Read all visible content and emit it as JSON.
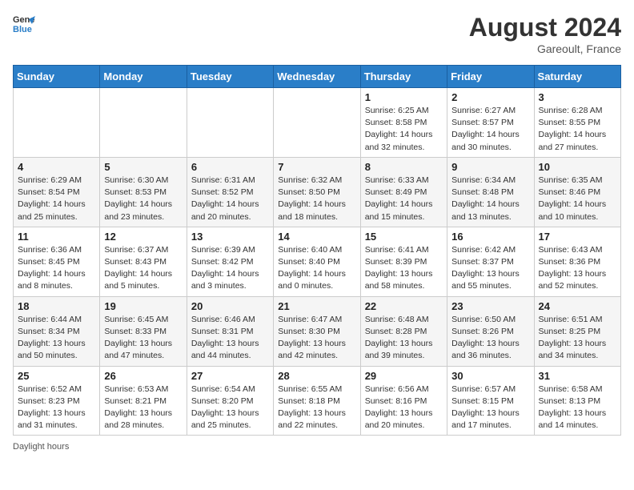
{
  "header": {
    "logo_general": "General",
    "logo_blue": "Blue",
    "month_year": "August 2024",
    "location": "Gareoult, France"
  },
  "footer": {
    "note": "Daylight hours"
  },
  "weekdays": [
    "Sunday",
    "Monday",
    "Tuesday",
    "Wednesday",
    "Thursday",
    "Friday",
    "Saturday"
  ],
  "weeks": [
    [
      {
        "day": "",
        "info": ""
      },
      {
        "day": "",
        "info": ""
      },
      {
        "day": "",
        "info": ""
      },
      {
        "day": "",
        "info": ""
      },
      {
        "day": "1",
        "info": "Sunrise: 6:25 AM\nSunset: 8:58 PM\nDaylight: 14 hours and 32 minutes."
      },
      {
        "day": "2",
        "info": "Sunrise: 6:27 AM\nSunset: 8:57 PM\nDaylight: 14 hours and 30 minutes."
      },
      {
        "day": "3",
        "info": "Sunrise: 6:28 AM\nSunset: 8:55 PM\nDaylight: 14 hours and 27 minutes."
      }
    ],
    [
      {
        "day": "4",
        "info": "Sunrise: 6:29 AM\nSunset: 8:54 PM\nDaylight: 14 hours and 25 minutes."
      },
      {
        "day": "5",
        "info": "Sunrise: 6:30 AM\nSunset: 8:53 PM\nDaylight: 14 hours and 23 minutes."
      },
      {
        "day": "6",
        "info": "Sunrise: 6:31 AM\nSunset: 8:52 PM\nDaylight: 14 hours and 20 minutes."
      },
      {
        "day": "7",
        "info": "Sunrise: 6:32 AM\nSunset: 8:50 PM\nDaylight: 14 hours and 18 minutes."
      },
      {
        "day": "8",
        "info": "Sunrise: 6:33 AM\nSunset: 8:49 PM\nDaylight: 14 hours and 15 minutes."
      },
      {
        "day": "9",
        "info": "Sunrise: 6:34 AM\nSunset: 8:48 PM\nDaylight: 14 hours and 13 minutes."
      },
      {
        "day": "10",
        "info": "Sunrise: 6:35 AM\nSunset: 8:46 PM\nDaylight: 14 hours and 10 minutes."
      }
    ],
    [
      {
        "day": "11",
        "info": "Sunrise: 6:36 AM\nSunset: 8:45 PM\nDaylight: 14 hours and 8 minutes."
      },
      {
        "day": "12",
        "info": "Sunrise: 6:37 AM\nSunset: 8:43 PM\nDaylight: 14 hours and 5 minutes."
      },
      {
        "day": "13",
        "info": "Sunrise: 6:39 AM\nSunset: 8:42 PM\nDaylight: 14 hours and 3 minutes."
      },
      {
        "day": "14",
        "info": "Sunrise: 6:40 AM\nSunset: 8:40 PM\nDaylight: 14 hours and 0 minutes."
      },
      {
        "day": "15",
        "info": "Sunrise: 6:41 AM\nSunset: 8:39 PM\nDaylight: 13 hours and 58 minutes."
      },
      {
        "day": "16",
        "info": "Sunrise: 6:42 AM\nSunset: 8:37 PM\nDaylight: 13 hours and 55 minutes."
      },
      {
        "day": "17",
        "info": "Sunrise: 6:43 AM\nSunset: 8:36 PM\nDaylight: 13 hours and 52 minutes."
      }
    ],
    [
      {
        "day": "18",
        "info": "Sunrise: 6:44 AM\nSunset: 8:34 PM\nDaylight: 13 hours and 50 minutes."
      },
      {
        "day": "19",
        "info": "Sunrise: 6:45 AM\nSunset: 8:33 PM\nDaylight: 13 hours and 47 minutes."
      },
      {
        "day": "20",
        "info": "Sunrise: 6:46 AM\nSunset: 8:31 PM\nDaylight: 13 hours and 44 minutes."
      },
      {
        "day": "21",
        "info": "Sunrise: 6:47 AM\nSunset: 8:30 PM\nDaylight: 13 hours and 42 minutes."
      },
      {
        "day": "22",
        "info": "Sunrise: 6:48 AM\nSunset: 8:28 PM\nDaylight: 13 hours and 39 minutes."
      },
      {
        "day": "23",
        "info": "Sunrise: 6:50 AM\nSunset: 8:26 PM\nDaylight: 13 hours and 36 minutes."
      },
      {
        "day": "24",
        "info": "Sunrise: 6:51 AM\nSunset: 8:25 PM\nDaylight: 13 hours and 34 minutes."
      }
    ],
    [
      {
        "day": "25",
        "info": "Sunrise: 6:52 AM\nSunset: 8:23 PM\nDaylight: 13 hours and 31 minutes."
      },
      {
        "day": "26",
        "info": "Sunrise: 6:53 AM\nSunset: 8:21 PM\nDaylight: 13 hours and 28 minutes."
      },
      {
        "day": "27",
        "info": "Sunrise: 6:54 AM\nSunset: 8:20 PM\nDaylight: 13 hours and 25 minutes."
      },
      {
        "day": "28",
        "info": "Sunrise: 6:55 AM\nSunset: 8:18 PM\nDaylight: 13 hours and 22 minutes."
      },
      {
        "day": "29",
        "info": "Sunrise: 6:56 AM\nSunset: 8:16 PM\nDaylight: 13 hours and 20 minutes."
      },
      {
        "day": "30",
        "info": "Sunrise: 6:57 AM\nSunset: 8:15 PM\nDaylight: 13 hours and 17 minutes."
      },
      {
        "day": "31",
        "info": "Sunrise: 6:58 AM\nSunset: 8:13 PM\nDaylight: 13 hours and 14 minutes."
      }
    ]
  ]
}
